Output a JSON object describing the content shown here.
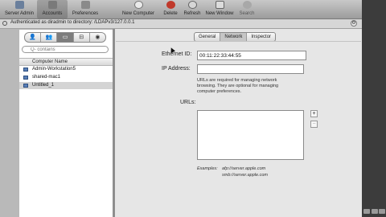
{
  "toolbar": {
    "items": [
      {
        "label": "Server Admin",
        "icon": "server-admin-icon"
      },
      {
        "label": "Accounts",
        "icon": "accounts-icon",
        "selected": true
      },
      {
        "label": "Preferences",
        "icon": "preferences-icon"
      },
      {
        "label": "New Computer",
        "icon": "new-computer-icon"
      },
      {
        "label": "Delete",
        "icon": "delete-icon"
      },
      {
        "label": "Refresh",
        "icon": "refresh-icon"
      },
      {
        "label": "New Window",
        "icon": "new-window-icon"
      },
      {
        "label": "Search",
        "icon": "search-icon"
      }
    ]
  },
  "authbar": {
    "text": "Authenticated as diradmin to directory: /LDAPv3/127.0.0.1"
  },
  "sidebar": {
    "segments": [
      {
        "glyph": "👤",
        "name": "users"
      },
      {
        "glyph": "👥",
        "name": "groups"
      },
      {
        "glyph": "▭",
        "name": "computers",
        "selected": true
      },
      {
        "glyph": "⊟",
        "name": "computer-groups"
      },
      {
        "glyph": "◉",
        "name": "other"
      }
    ],
    "search_placeholder": "Q- contains",
    "column_header": "Computer Name",
    "rows": [
      {
        "label": "Admin-Workstation5"
      },
      {
        "label": "shared-mac1"
      },
      {
        "label": "Untitled_1",
        "selected": true
      }
    ]
  },
  "tabs": [
    {
      "label": "General"
    },
    {
      "label": "Network",
      "selected": true
    },
    {
      "label": "Inspector"
    }
  ],
  "network": {
    "ethernet_label": "Ethernet ID:",
    "ethernet_value": "00:11:22:33:44:55",
    "ip_label": "IP Address:",
    "ip_value": "",
    "help_text": "URLs are required for managing network browsing. They are optional for managing computer preferences.",
    "urls_label": "URLs:",
    "add_button": "+",
    "remove_button": "−",
    "examples_label": "Examples:",
    "example1": "afp://server.apple.com",
    "example2": "smb://server.apple.com"
  }
}
